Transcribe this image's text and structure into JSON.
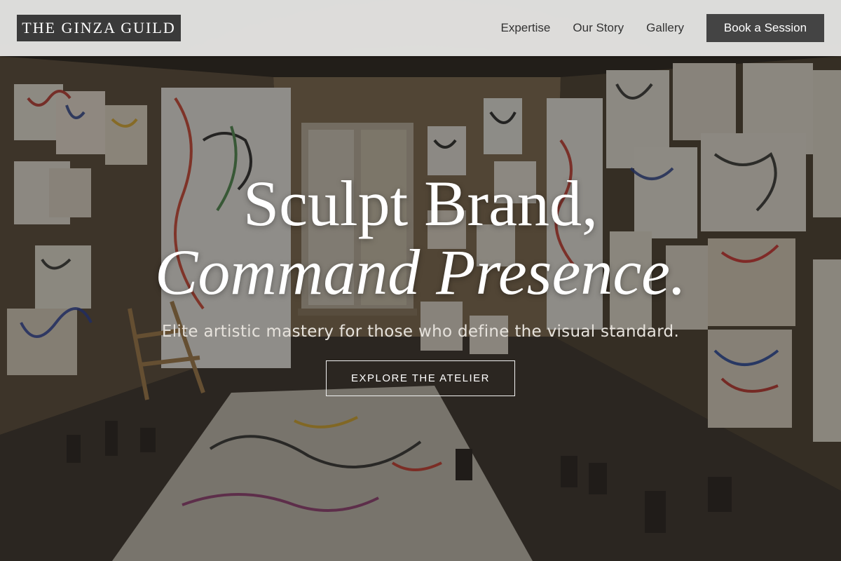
{
  "brand": {
    "name": "THE GINZA GUILD"
  },
  "nav": {
    "items": [
      {
        "label": "Expertise"
      },
      {
        "label": "Our Story"
      },
      {
        "label": "Gallery"
      }
    ],
    "cta_label": "Book a Session"
  },
  "hero": {
    "headline_line1": "Sculpt Brand,",
    "headline_line2": "Command Presence.",
    "subtitle": "Elite artistic mastery for those who define the visual standard.",
    "button_label": "EXPLORE THE ATELIER",
    "background": "artist-studio-photo"
  },
  "colors": {
    "header_bg": "#e4e4e2",
    "logo_bg": "#3a3a3a",
    "cta_bg": "#444444",
    "text_light": "#ffffff"
  }
}
